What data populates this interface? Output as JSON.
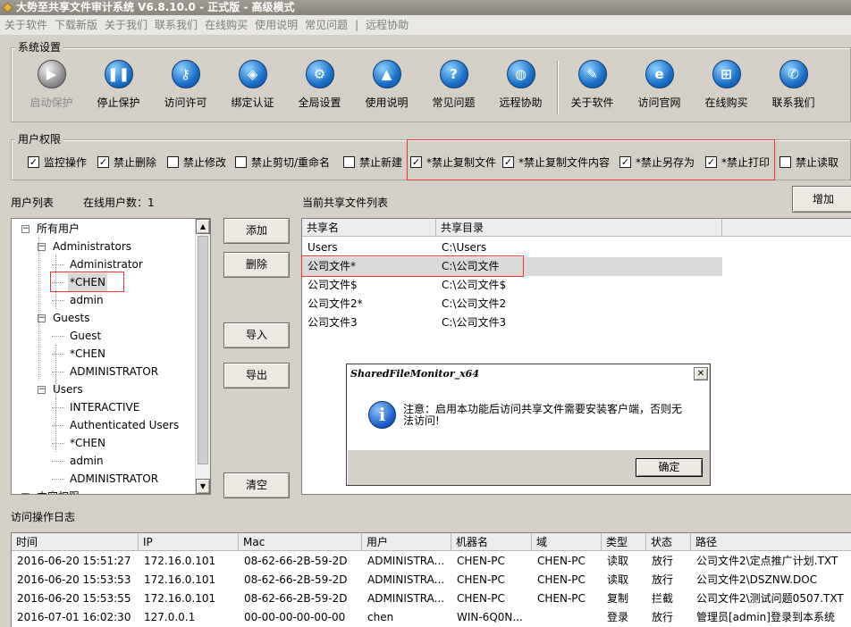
{
  "window": {
    "title": "大势至共享文件审计系统 V6.8.10.0 - 正式版 - 高级模式"
  },
  "menu": [
    "关于软件",
    "下载新版",
    "关于我们",
    "联系我们",
    "在线购买",
    "使用说明",
    "常见问题",
    "|",
    "远程协助"
  ],
  "system_settings": {
    "label": "系统设置",
    "buttons": [
      {
        "label": "启动保护",
        "icon": "play-icon",
        "glyph": "▶",
        "disabled": true
      },
      {
        "label": "停止保护",
        "icon": "pause-icon",
        "glyph": "❚❚",
        "disabled": false
      },
      {
        "label": "访问许可",
        "icon": "key-icon",
        "glyph": "⚷",
        "disabled": false
      },
      {
        "label": "绑定认证",
        "icon": "shield-icon",
        "glyph": "◈",
        "disabled": false
      },
      {
        "label": "全局设置",
        "icon": "gear-icon",
        "glyph": "⚙",
        "disabled": false
      },
      {
        "label": "使用说明",
        "icon": "graduation-cap-icon",
        "glyph": "▲",
        "disabled": false
      },
      {
        "label": "常见问题",
        "icon": "question-icon",
        "glyph": "?",
        "disabled": false
      },
      {
        "label": "远程协助",
        "icon": "globe-icon",
        "glyph": "◍",
        "disabled": false
      },
      {
        "label": "关于软件",
        "icon": "document-icon",
        "glyph": "✎",
        "disabled": false
      },
      {
        "label": "访问官网",
        "icon": "browser-icon",
        "glyph": "e",
        "disabled": false
      },
      {
        "label": "在线购买",
        "icon": "cart-icon",
        "glyph": "⊞",
        "disabled": false
      },
      {
        "label": "联系我们",
        "icon": "phone-icon",
        "glyph": "✆",
        "disabled": false
      }
    ]
  },
  "user_permissions": {
    "label": "用户权限",
    "checkboxes": [
      {
        "label": "监控操作",
        "checked": true
      },
      {
        "label": "禁止删除",
        "checked": true
      },
      {
        "label": "禁止修改",
        "checked": false
      },
      {
        "label": "禁止剪切/重命名",
        "checked": false
      },
      {
        "label": "禁止新建",
        "checked": false
      },
      {
        "label": "*禁止复制文件",
        "checked": true
      },
      {
        "label": "*禁止复制文件内容",
        "checked": true
      },
      {
        "label": "*禁止另存为",
        "checked": true
      },
      {
        "label": "*禁止打印",
        "checked": true
      },
      {
        "label": "禁止读取",
        "checked": false
      }
    ]
  },
  "user_list": {
    "label": "用户列表",
    "online_label": "在线用户数：1",
    "tree": [
      {
        "text": "所有用户",
        "level": 0,
        "expander": "-"
      },
      {
        "text": "Administrators",
        "level": 1,
        "expander": "-"
      },
      {
        "text": "Administrator",
        "level": 2
      },
      {
        "text": "*CHEN",
        "level": 2,
        "selected": true
      },
      {
        "text": "admin",
        "level": 2
      },
      {
        "text": "Guests",
        "level": 1,
        "expander": "-"
      },
      {
        "text": "Guest",
        "level": 2
      },
      {
        "text": "*CHEN",
        "level": 2
      },
      {
        "text": "ADMINISTRATOR",
        "level": 2
      },
      {
        "text": "Users",
        "level": 1,
        "expander": "-"
      },
      {
        "text": "INTERACTIVE",
        "level": 2
      },
      {
        "text": "Authenticated Users",
        "level": 2
      },
      {
        "text": "*CHEN",
        "level": 2
      },
      {
        "text": "admin",
        "level": 2
      },
      {
        "text": "ADMINISTRATOR",
        "level": 2
      },
      {
        "text": "内容权限",
        "level": 0,
        "expander": "+"
      }
    ]
  },
  "side_buttons": {
    "add": "添加",
    "delete": "删除",
    "import": "导入",
    "export": "导出",
    "clear": "清空"
  },
  "shared_files": {
    "label": "当前共享文件列表",
    "add_button": "增加",
    "columns": [
      "共享名",
      "共享目录"
    ],
    "rows": [
      {
        "name": "Users",
        "path": "C:\\Users"
      },
      {
        "name": "公司文件*",
        "path": "C:\\公司文件",
        "selected": true
      },
      {
        "name": "公司文件$",
        "path": "C:\\公司文件$"
      },
      {
        "name": "公司文件2*",
        "path": "C:\\公司文件2"
      },
      {
        "name": "公司文件3",
        "path": "C:\\公司文件3"
      }
    ]
  },
  "dialog": {
    "title": "SharedFileMonitor_x64",
    "message": "注意：启用本功能后访问共享文件需要安装客户端，否则无法访问!",
    "ok": "确定",
    "close": "✕",
    "icon": "info-icon"
  },
  "log": {
    "label": "访问操作日志",
    "columns": [
      "时间",
      "IP",
      "Mac",
      "用户",
      "机器名",
      "域",
      "类型",
      "状态",
      "路径"
    ],
    "rows": [
      [
        "2016-06-20 15:51:27",
        "172.16.0.101",
        "08-62-66-2B-59-2D",
        "ADMINISTRA...",
        "CHEN-PC",
        "CHEN-PC",
        "读取",
        "放行",
        "公司文件2\\定点推广计划.TXT"
      ],
      [
        "2016-06-20 15:53:53",
        "172.16.0.101",
        "08-62-66-2B-59-2D",
        "ADMINISTRA...",
        "CHEN-PC",
        "CHEN-PC",
        "读取",
        "放行",
        "公司文件2\\DSZNW.DOC"
      ],
      [
        "2016-06-20 15:53:55",
        "172.16.0.101",
        "08-62-66-2B-59-2D",
        "ADMINISTRA...",
        "CHEN-PC",
        "CHEN-PC",
        "复制",
        "拦截",
        "公司文件2\\测试问题0507.TXT"
      ],
      [
        "2016-07-01 16:02:30",
        "127.0.0.1",
        "00-00-00-00-00-00",
        "chen",
        "WIN-6Q0N...",
        "",
        "登录",
        "放行",
        "管理员[admin]登录到本系统"
      ]
    ]
  }
}
